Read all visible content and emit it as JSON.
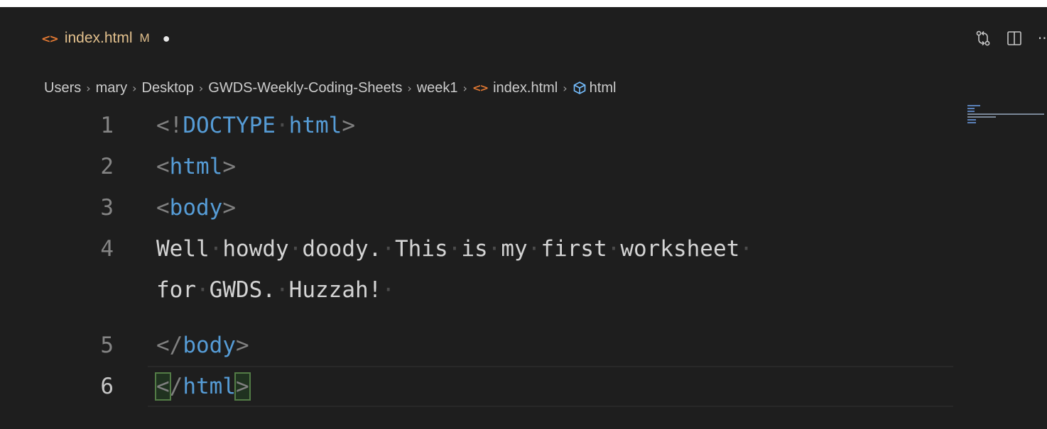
{
  "tab": {
    "file_icon": "<>",
    "filename": "index.html",
    "git_status": "M",
    "dirty_indicator": "●"
  },
  "tab_actions": {
    "source_control_icon": "compare-changes-icon",
    "split_editor_icon": "split-editor-icon",
    "more_actions": "···"
  },
  "breadcrumb": {
    "items": [
      "Users",
      "mary",
      "Desktop",
      "GWDS-Weekly-Coding-Sheets",
      "week1",
      "index.html",
      "html"
    ],
    "separator": "›"
  },
  "editor": {
    "line_numbers": [
      "1",
      "2",
      "3",
      "4",
      "5",
      "6"
    ],
    "active_line": "6",
    "lines": {
      "l1_open": "<!",
      "l1_doctype": "DOCTYPE",
      "l1_html": "html",
      "l1_close": ">",
      "l2_open": "<",
      "l2_tag": "html",
      "l2_close": ">",
      "l3_open": "<",
      "l3_tag": "body",
      "l3_close": ">",
      "l4_text": "Well howdy doody. This is my first worksheet",
      "l4_wrap": "for GWDS. Huzzah!",
      "l5_open": "</",
      "l5_tag": "body",
      "l5_close": ">",
      "l6_open": "<",
      "l6_slash": "/",
      "l6_tag": "html",
      "l6_close": ">"
    }
  },
  "colors": {
    "background": "#1e1e1e",
    "tag_name": "#569cd6",
    "tag_bracket": "#808080",
    "text": "#d4d4d4",
    "modified": "#e2c08d",
    "html_file_icon": "#e37933"
  }
}
